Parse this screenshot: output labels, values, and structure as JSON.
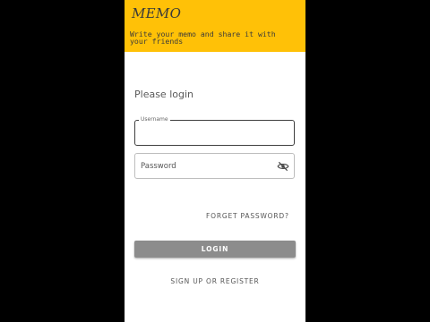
{
  "header": {
    "title": "MEMO",
    "subtitle": "Write your memo and share it with your friends",
    "background": "#FFC107"
  },
  "login": {
    "heading": "Please login",
    "username": {
      "label": "Username",
      "value": ""
    },
    "password": {
      "placeholder": "Password",
      "value": "",
      "visibility_icon": "visibility-off-icon"
    },
    "forgot_label": "FORGET PASSWORD?",
    "login_label": "LOGIN",
    "signup_label": "SIGN UP OR REGISTER"
  }
}
